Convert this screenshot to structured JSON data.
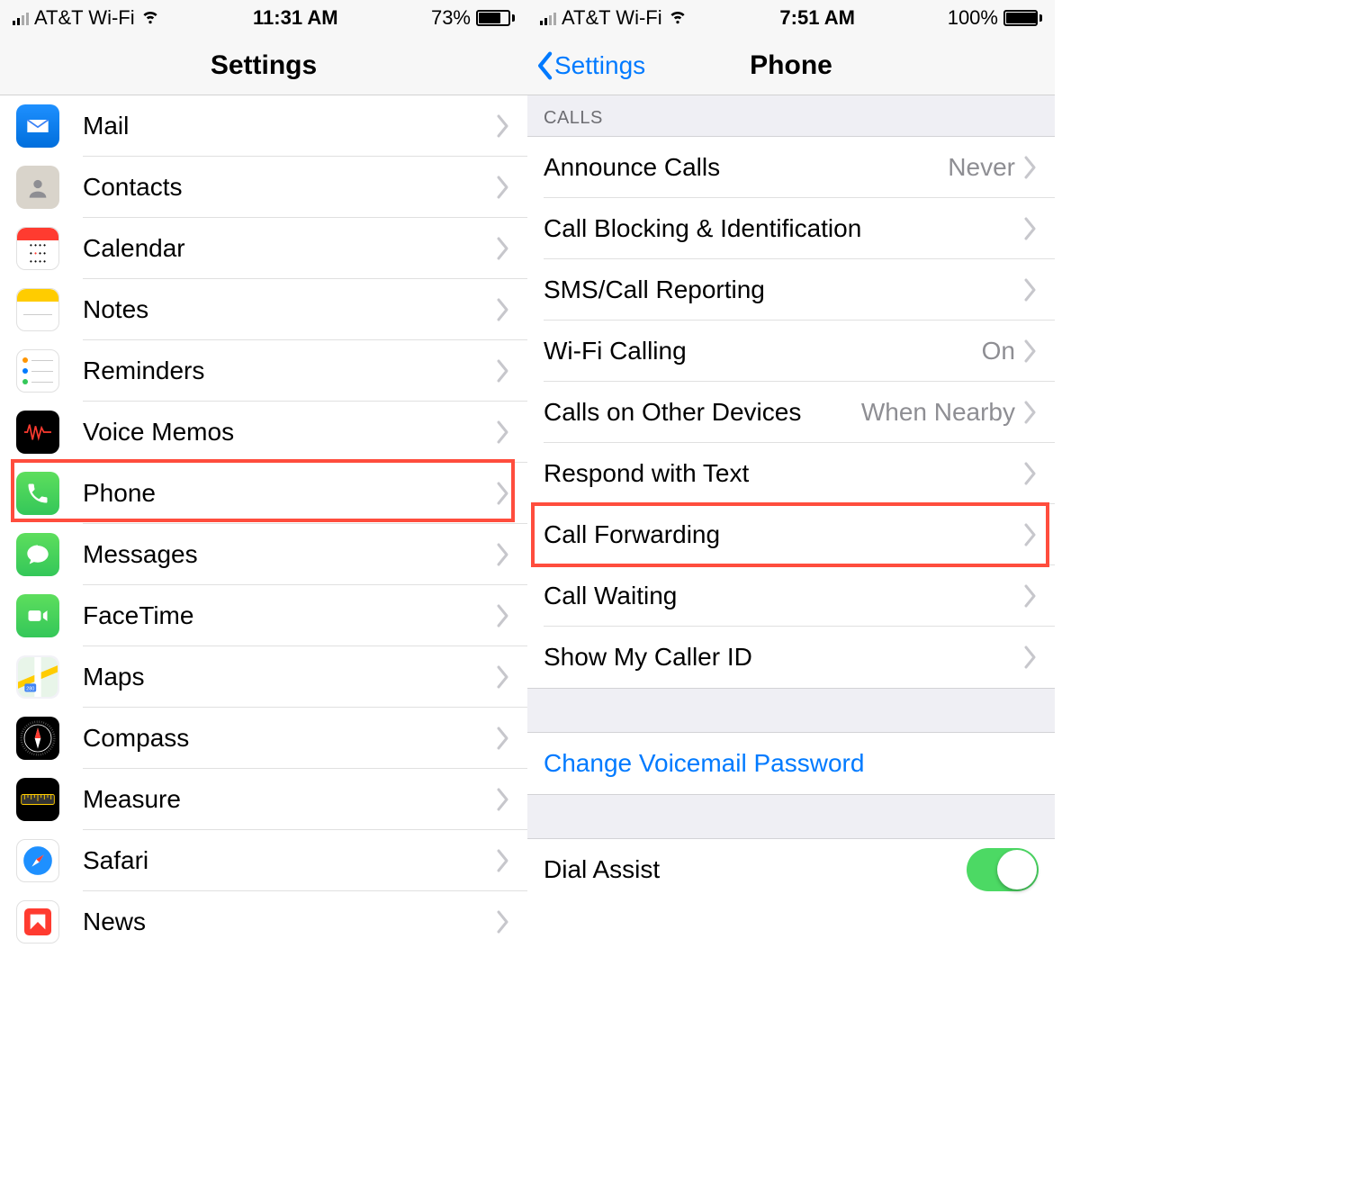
{
  "left": {
    "status": {
      "carrier": "AT&T Wi-Fi",
      "time": "11:31 AM",
      "battery_pct": "73%",
      "battery_fill": 73
    },
    "nav_title": "Settings",
    "items": [
      {
        "key": "mail",
        "label": "Mail"
      },
      {
        "key": "contacts",
        "label": "Contacts"
      },
      {
        "key": "calendar",
        "label": "Calendar"
      },
      {
        "key": "notes",
        "label": "Notes"
      },
      {
        "key": "reminders",
        "label": "Reminders"
      },
      {
        "key": "voicememos",
        "label": "Voice Memos"
      },
      {
        "key": "phone",
        "label": "Phone"
      },
      {
        "key": "messages",
        "label": "Messages"
      },
      {
        "key": "facetime",
        "label": "FaceTime"
      },
      {
        "key": "maps",
        "label": "Maps"
      },
      {
        "key": "compass",
        "label": "Compass"
      },
      {
        "key": "measure",
        "label": "Measure"
      },
      {
        "key": "safari",
        "label": "Safari"
      },
      {
        "key": "news",
        "label": "News"
      }
    ],
    "highlight_index": 6
  },
  "right": {
    "status": {
      "carrier": "AT&T Wi-Fi",
      "time": "7:51 AM",
      "battery_pct": "100%",
      "battery_fill": 100
    },
    "nav_back": "Settings",
    "nav_title": "Phone",
    "section_calls": "CALLS",
    "rows": [
      {
        "key": "announce",
        "label": "Announce Calls",
        "value": "Never"
      },
      {
        "key": "blocking",
        "label": "Call Blocking & Identification"
      },
      {
        "key": "sms",
        "label": "SMS/Call Reporting"
      },
      {
        "key": "wifi",
        "label": "Wi-Fi Calling",
        "value": "On"
      },
      {
        "key": "otherdev",
        "label": "Calls on Other Devices",
        "value": "When Nearby"
      },
      {
        "key": "respond",
        "label": "Respond with Text"
      },
      {
        "key": "forwarding",
        "label": "Call Forwarding"
      },
      {
        "key": "waiting",
        "label": "Call Waiting"
      },
      {
        "key": "callerid",
        "label": "Show My Caller ID"
      }
    ],
    "voicemail_link": "Change Voicemail Password",
    "dial_assist": "Dial Assist",
    "highlight_index": 6
  }
}
